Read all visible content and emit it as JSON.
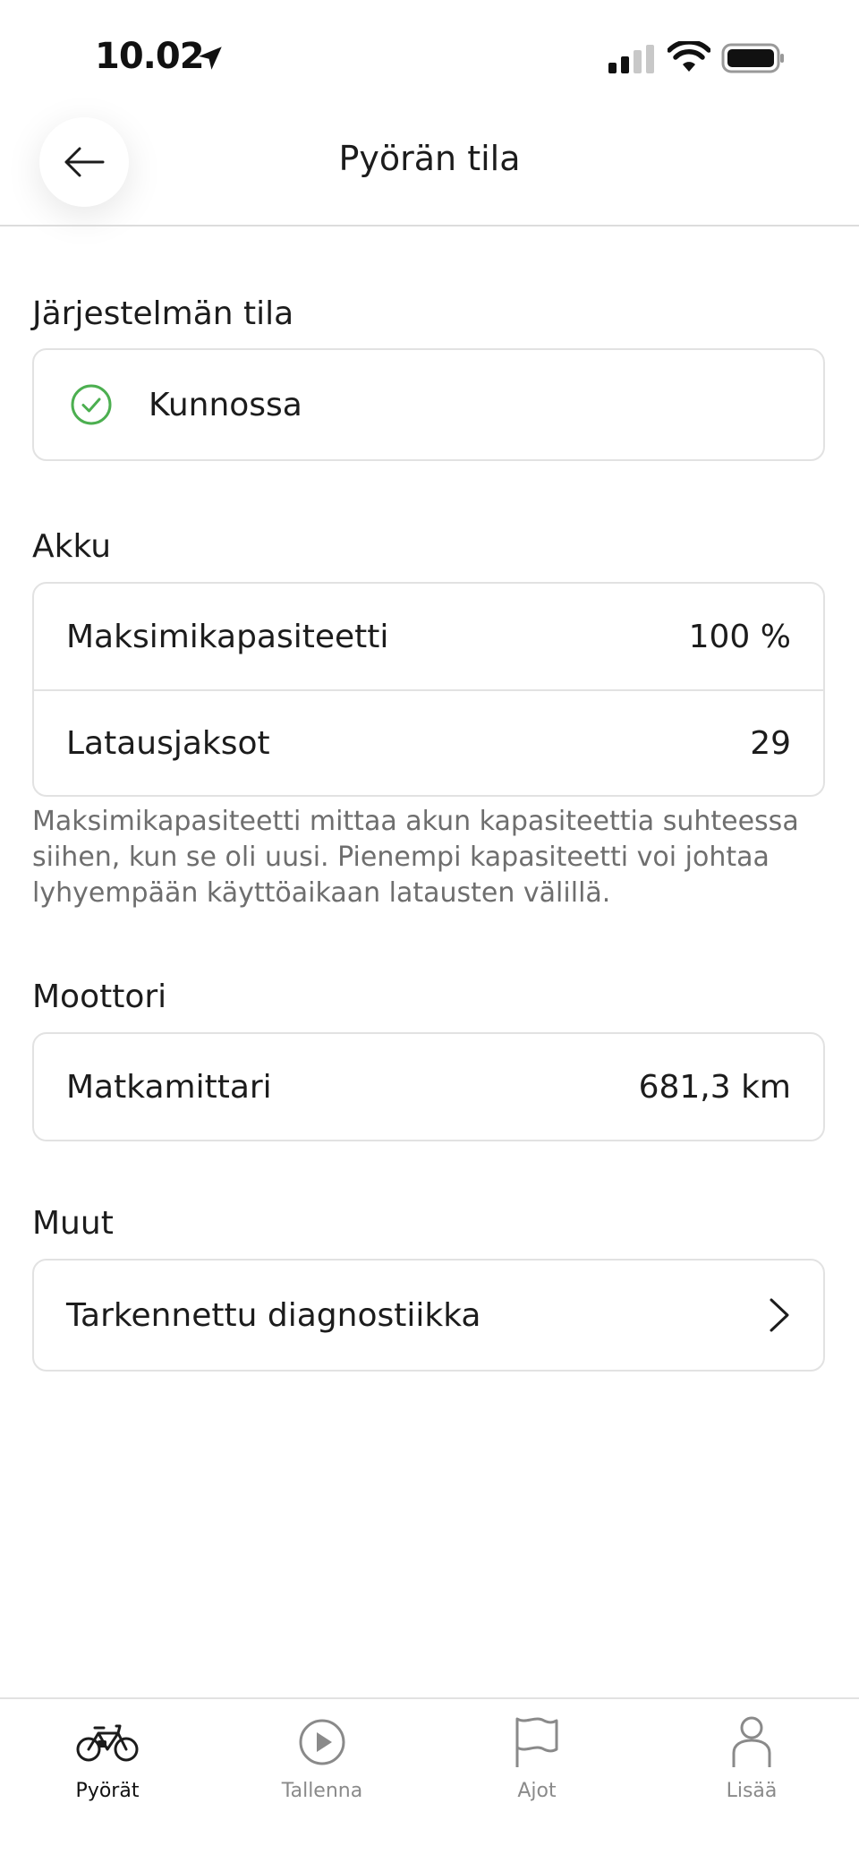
{
  "status_bar": {
    "time": "10.02"
  },
  "header": {
    "title": "Pyörän tila"
  },
  "system": {
    "title": "Järjestelmän tila",
    "status_text": "Kunnossa",
    "status_color": "#4caf50"
  },
  "battery": {
    "title": "Akku",
    "rows": [
      {
        "label": "Maksimikapasiteetti",
        "value": "100 %"
      },
      {
        "label": "Latausjaksot",
        "value": "29"
      }
    ],
    "note": "Maksimikapasiteetti mittaa akun kapasiteettia suhteessa siihen, kun se oli uusi. Pienempi kapasiteetti voi johtaa lyhyempään käyttöaikaan latausten välillä."
  },
  "motor": {
    "title": "Moottori",
    "rows": [
      {
        "label": "Matkamittari",
        "value": "681,3 km"
      }
    ]
  },
  "other": {
    "title": "Muut",
    "rows": [
      {
        "label": "Tarkennettu diagnostiikka"
      }
    ]
  },
  "tabs": [
    {
      "label": "Pyörät",
      "icon": "bike-icon",
      "active": true
    },
    {
      "label": "Tallenna",
      "icon": "play-icon",
      "active": false
    },
    {
      "label": "Ajot",
      "icon": "flag-icon",
      "active": false
    },
    {
      "label": "Lisää",
      "icon": "person-icon",
      "active": false
    }
  ]
}
